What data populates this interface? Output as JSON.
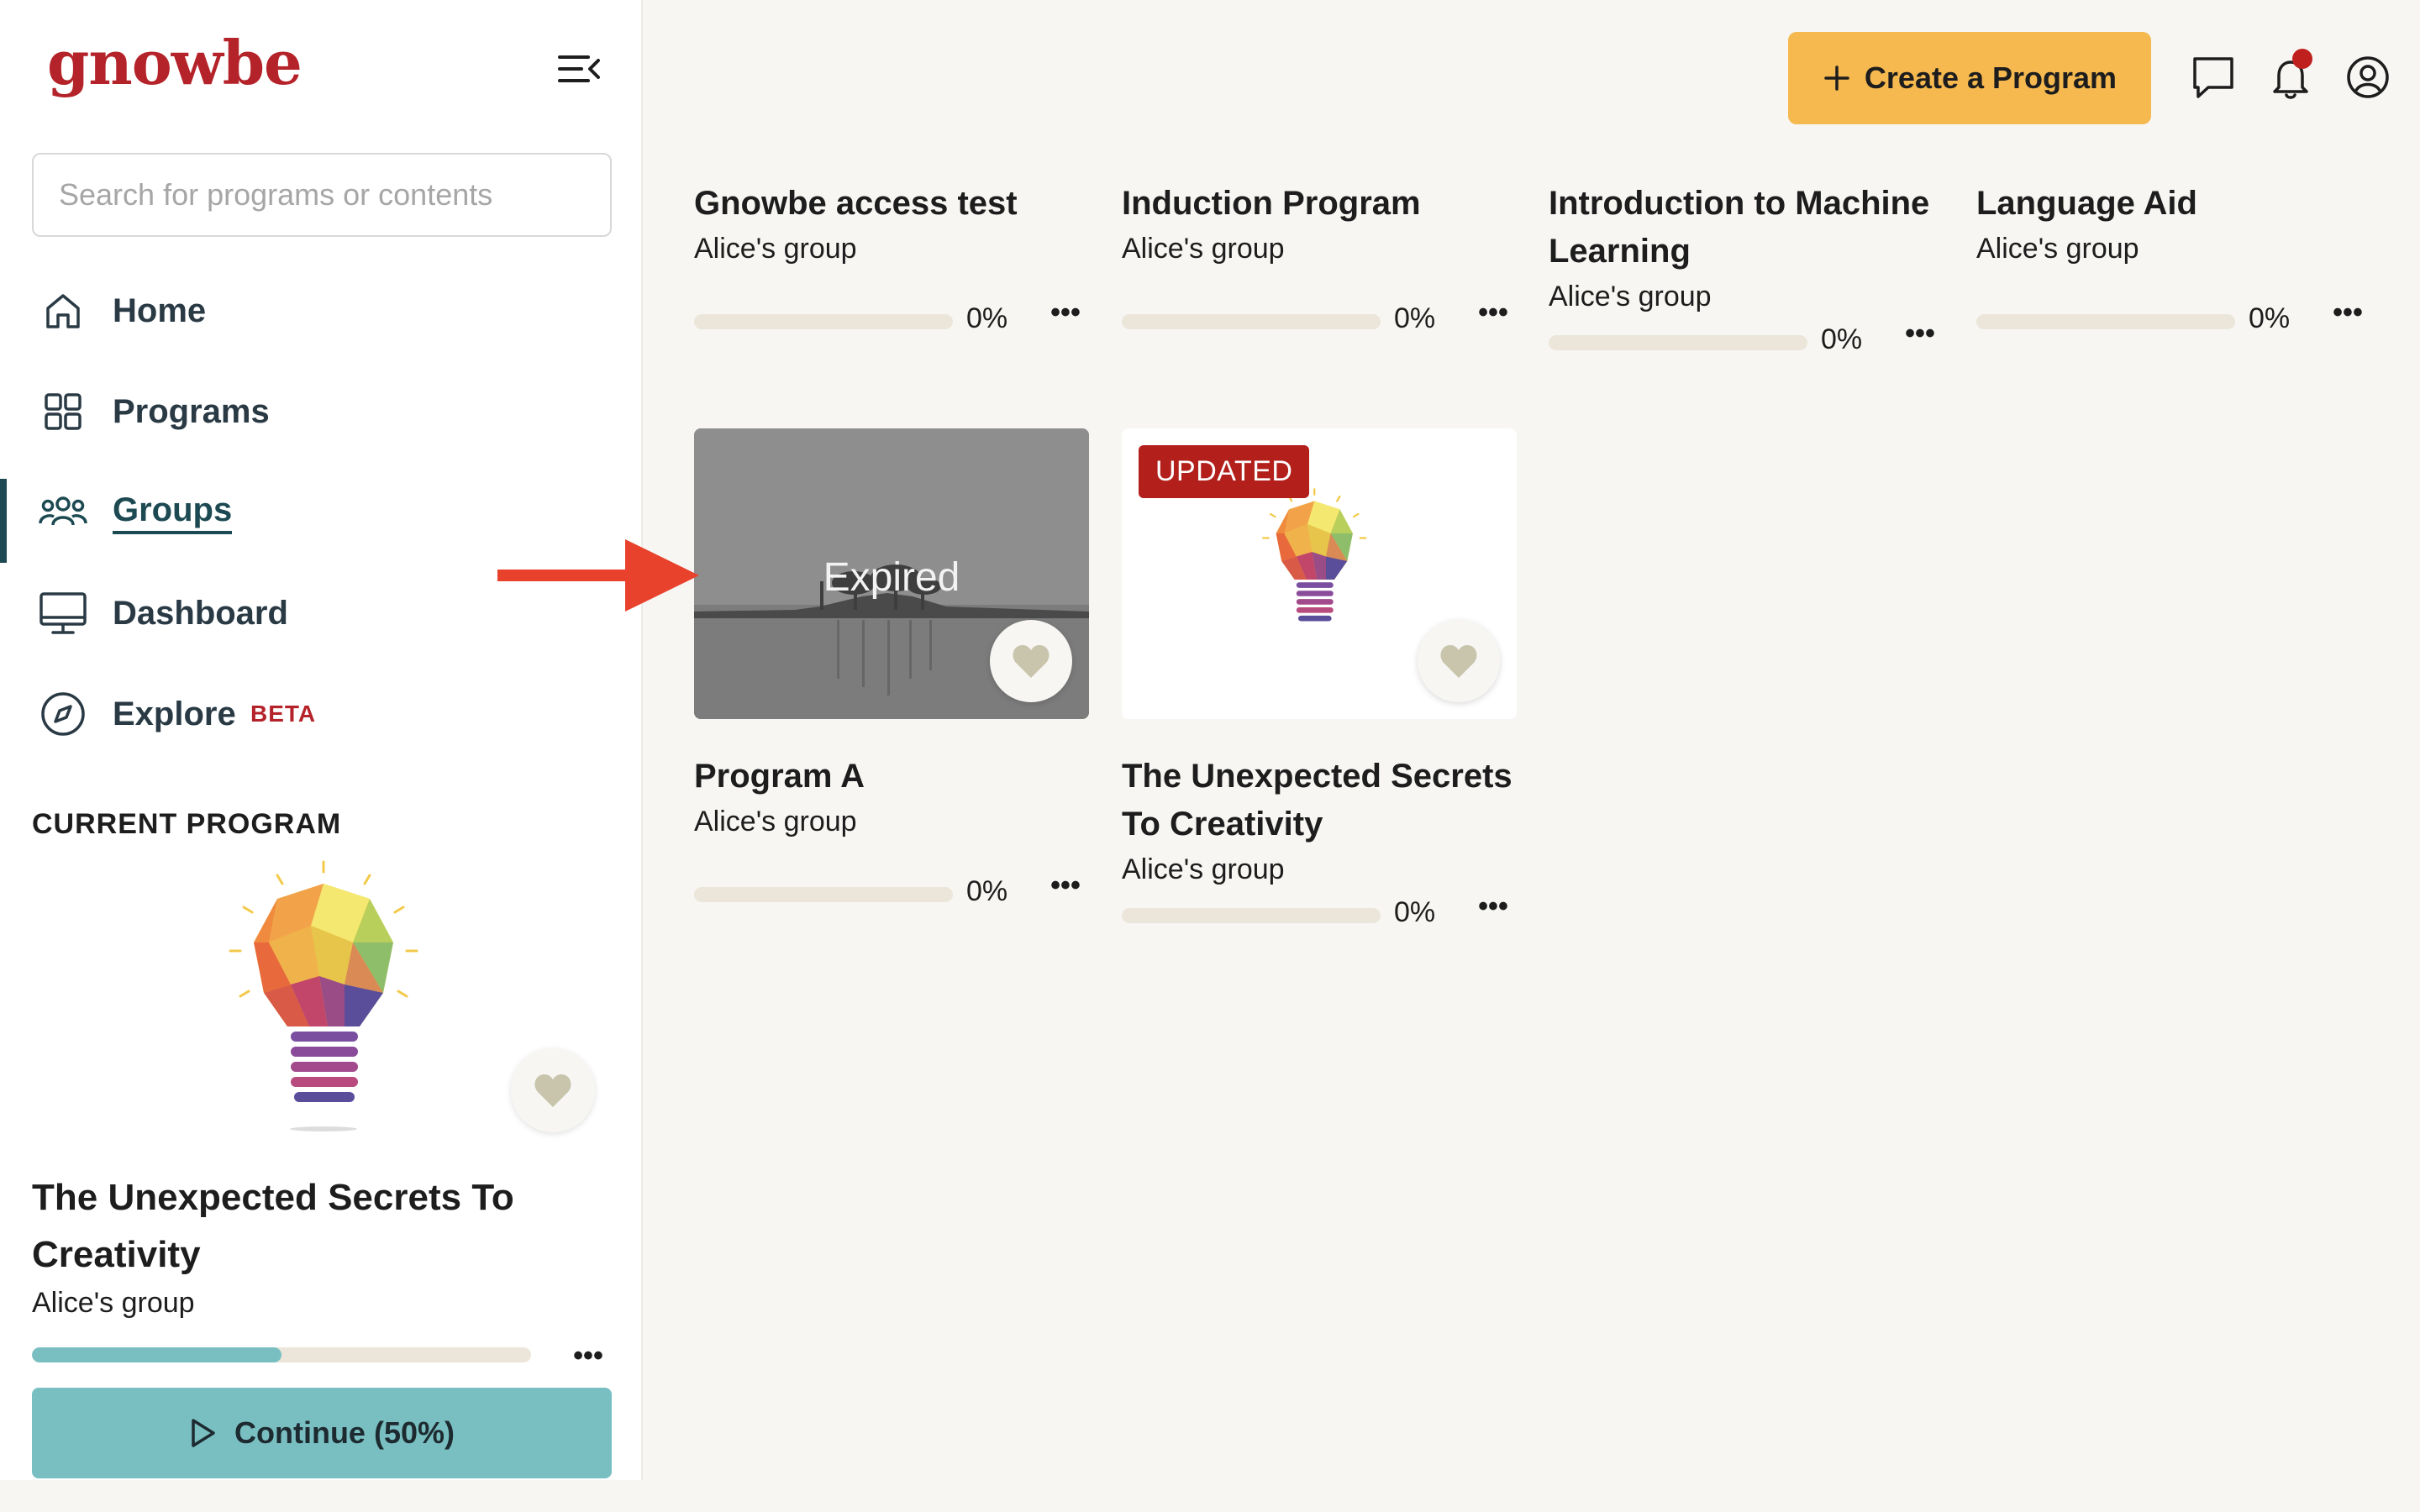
{
  "brand": {
    "logo_text": "gnowbe"
  },
  "search": {
    "placeholder": "Search for programs or contents"
  },
  "nav": {
    "items": [
      {
        "label": "Home",
        "icon": "home-icon"
      },
      {
        "label": "Programs",
        "icon": "grid-icon"
      },
      {
        "label": "Groups",
        "icon": "people-icon",
        "active": true
      },
      {
        "label": "Dashboard",
        "icon": "monitor-icon"
      },
      {
        "label": "Explore",
        "icon": "compass-icon",
        "badge": "BETA"
      }
    ]
  },
  "current_program": {
    "section_label": "CURRENT PROGRAM",
    "title": "The Unexpected Secrets To Creativity",
    "group": "Alice's group",
    "progress": 0.5,
    "continue_label": "Continue (50%)",
    "more_label": "•••"
  },
  "header": {
    "create_label": "Create a Program",
    "icons": [
      "chat-icon",
      "bell-icon",
      "profile-icon"
    ],
    "has_notification": true
  },
  "programs_row1": [
    {
      "title": "Gnowbe access test",
      "group": "Alice's group",
      "progress_label": "0%",
      "progress": 0
    },
    {
      "title": "Induction Program",
      "group": "Alice's group",
      "progress_label": "0%",
      "progress": 0
    },
    {
      "title": "Introduction to Machine Learning",
      "group": "Alice's group",
      "progress_label": "0%",
      "progress": 0
    },
    {
      "title": "Language Aid",
      "group": "Alice's group",
      "progress_label": "0%",
      "progress": 0
    }
  ],
  "programs_row2": [
    {
      "title": "Program A",
      "group": "Alice's group",
      "progress_label": "0%",
      "progress": 0,
      "overlay_text": "Expired"
    },
    {
      "title": "The Unexpected Secrets To Creativity",
      "group": "Alice's group",
      "progress_label": "0%",
      "progress": 0,
      "badge": "UPDATED"
    }
  ],
  "more_label": "•••",
  "colors": {
    "brand_red": "#b5232a",
    "accent_teal": "#79bfc2",
    "create_orange": "#f5b94f",
    "nav_active": "#1d4a52",
    "badge_red": "#b3201c",
    "annotation_arrow": "#e8412c"
  },
  "annotation": {
    "icon": "arrow-right-icon",
    "points_to": "Program A"
  }
}
